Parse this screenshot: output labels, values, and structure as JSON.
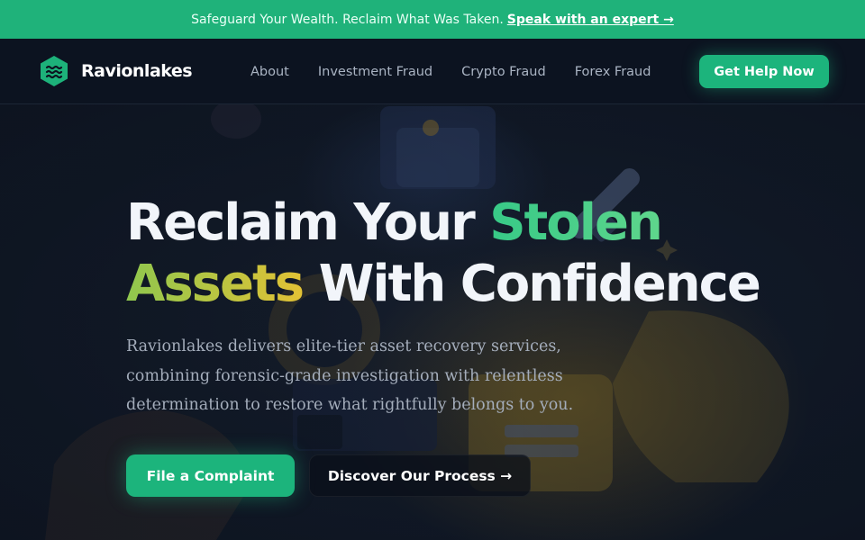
{
  "announcement": {
    "text": "Safeguard Your Wealth. Reclaim What Was Taken.",
    "link_label": "Speak with an expert →"
  },
  "nav": {
    "brand_name": "Ravionlakes",
    "brand_icon": "hexagon-waves-icon",
    "links": [
      "About",
      "Investment Fraud",
      "Crypto Fraud",
      "Forex Fraud"
    ],
    "cta_label": "Get Help Now"
  },
  "hero": {
    "headline": {
      "line1_plain": "Reclaim Your",
      "line1_accent": "Stolen",
      "line2_accent": "Assets",
      "line2_plain": "With Confidence"
    },
    "subtext": "Ravionlakes delivers elite-tier asset recovery services, combining forensic-grade investigation with relentless determination to restore what rightfully belongs to you.",
    "primary_button": "File a Complaint",
    "secondary_button": "Discover Our Process →"
  },
  "colors": {
    "accent_green": "#1cb47c",
    "headline_green": "#37c987",
    "headline_gold": "#e2c235",
    "background": "#0f1726"
  }
}
